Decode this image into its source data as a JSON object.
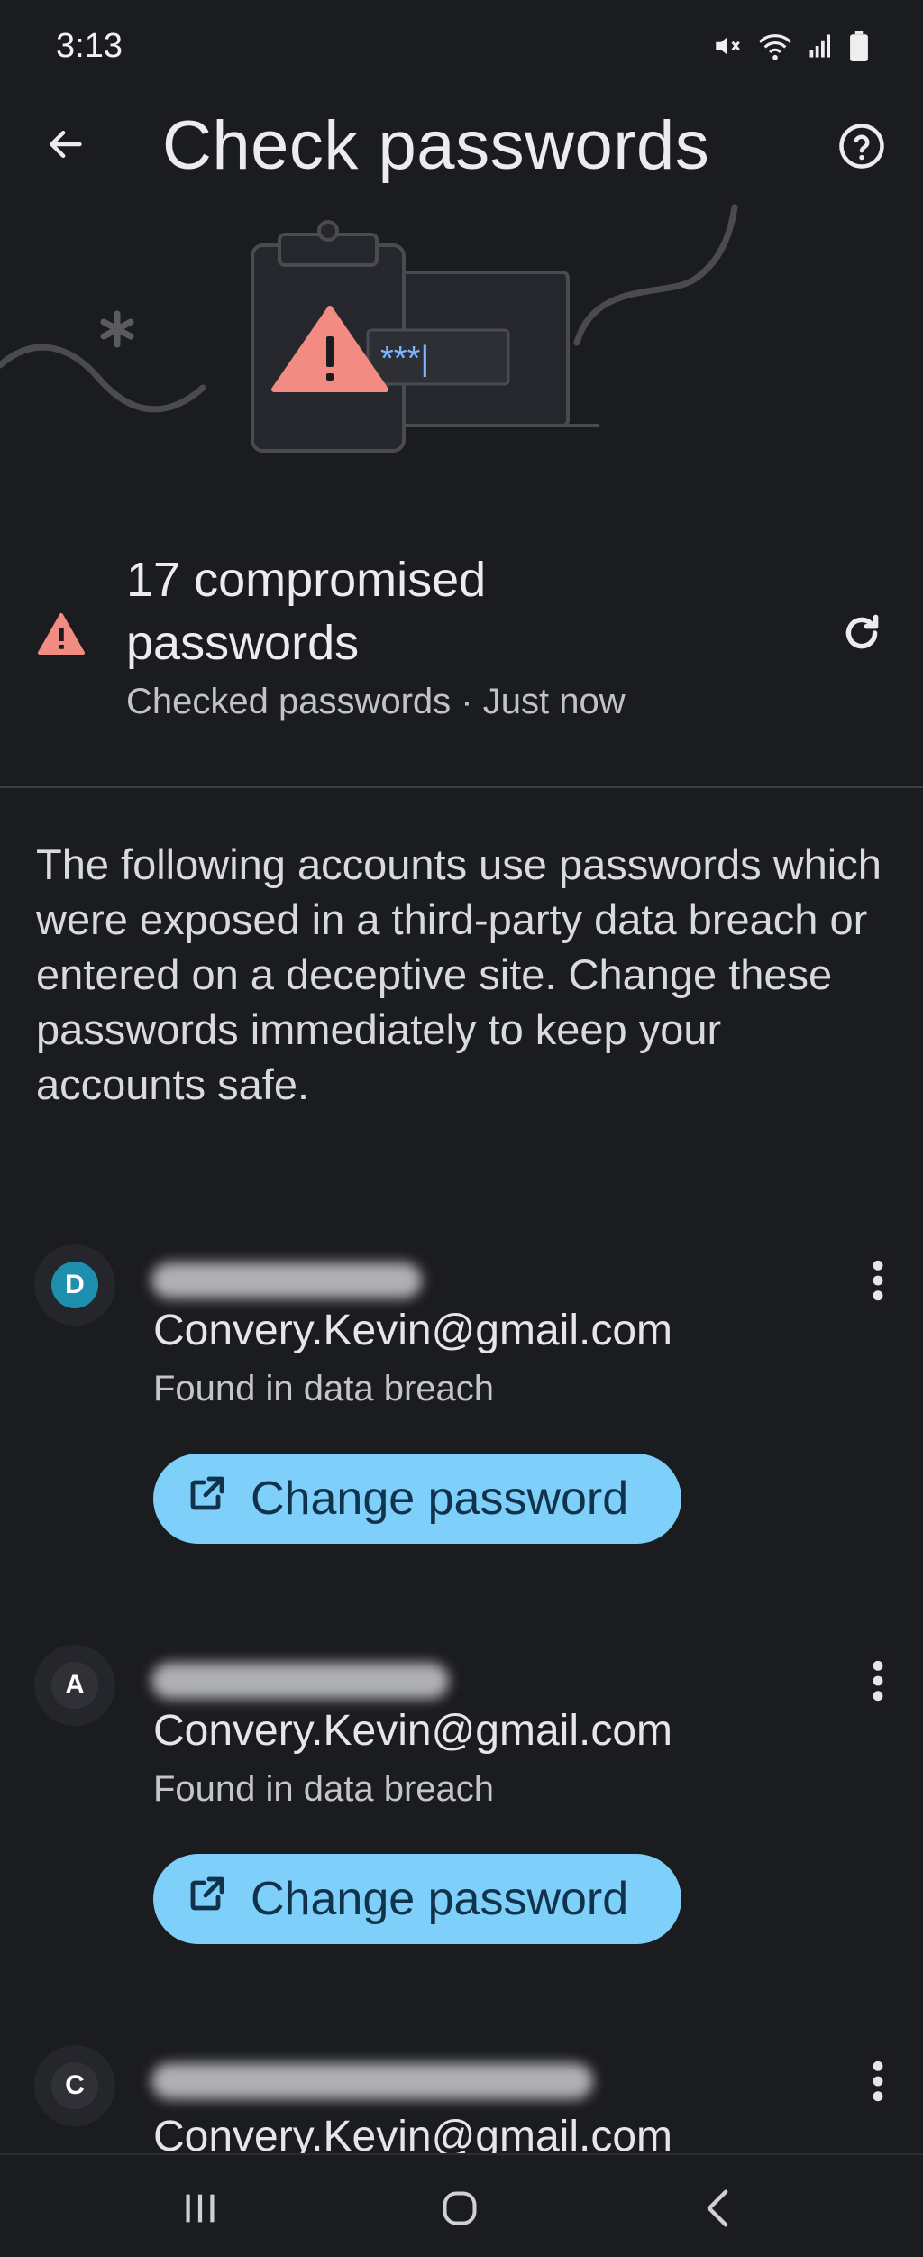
{
  "status_bar": {
    "time": "3:13",
    "icons": [
      "mute-icon",
      "wifi-icon",
      "signal-icon",
      "battery-icon"
    ]
  },
  "app_bar": {
    "title": "Check passwords",
    "back_icon": "back-arrow-icon",
    "help_icon": "help-icon"
  },
  "illustration": {
    "password_mask": "***|"
  },
  "summary": {
    "title": "17 compromised passwords",
    "subtitle": "Checked passwords · Just now",
    "warning_color": "#f28b82"
  },
  "description": "The following accounts use passwords which were exposed in a third-party data breach or entered on a deceptive site. Change these passwords immediately to keep your accounts safe.",
  "items": [
    {
      "avatar_letter": "D",
      "avatar_color": "#1f8fb0",
      "email": "Convery.Kevin@gmail.com",
      "status": "Found in data breach",
      "button_label": "Change password"
    },
    {
      "avatar_letter": "A",
      "avatar_color": "#303136",
      "email": "Convery.Kevin@gmail.com",
      "status": "Found in data breach",
      "button_label": "Change password"
    },
    {
      "avatar_letter": "C",
      "avatar_color": "#303136",
      "email": "Convery.Kevin@gmail.com"
    }
  ],
  "colors": {
    "background": "#1b1c20",
    "button": "#7ecff9",
    "button_text": "#10324a"
  }
}
